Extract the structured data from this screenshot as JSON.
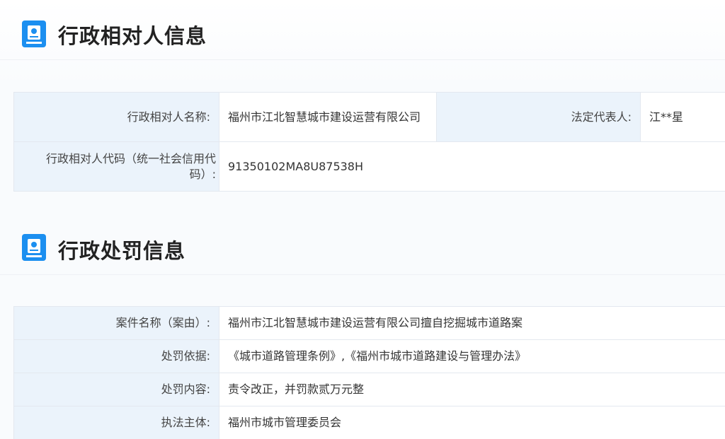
{
  "section1": {
    "title": "行政相对人信息",
    "icon": "badge-icon",
    "rows": {
      "name_label": "行政相对人名称:",
      "name_value": "福州市江北智慧城市建设运营有限公司",
      "legal_rep_label": "法定代表人:",
      "legal_rep_value": "江**星",
      "code_label": "行政相对人代码（统一社会信用代码）:",
      "code_value": "91350102MA8U87538H"
    }
  },
  "section2": {
    "title": "行政处罚信息",
    "icon": "badge-icon",
    "rows": {
      "case_label": "案件名称（案由）:",
      "case_value": "福州市江北智慧城市建设运营有限公司擅自挖掘城市道路案",
      "basis_label": "处罚依据:",
      "basis_value": "《城市道路管理条例》,《福州市城市道路建设与管理办法》",
      "content_label": "处罚内容:",
      "content_value": "责令改正，并罚款贰万元整",
      "authority_label": "执法主体:",
      "authority_value": "福州市城市管理委员会"
    }
  },
  "colors": {
    "accent": "#1c8ff0",
    "label_bg": "#ebf3fb",
    "border": "#e3e8ef"
  }
}
